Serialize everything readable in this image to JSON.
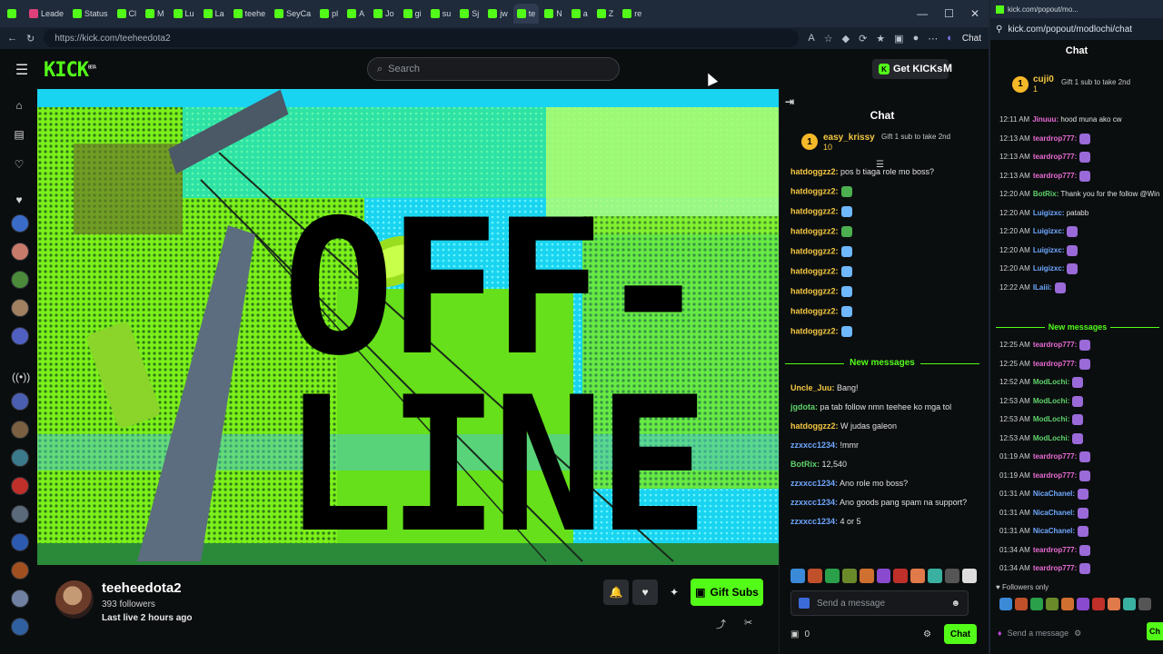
{
  "browser": {
    "tabs": [
      {
        "label": "",
        "active": false
      },
      {
        "label": "Leade",
        "active": false
      },
      {
        "label": "Status",
        "active": false
      },
      {
        "label": "Cl",
        "active": false
      },
      {
        "label": "M",
        "active": false
      },
      {
        "label": "Lu",
        "active": false
      },
      {
        "label": "La",
        "active": false
      },
      {
        "label": "teehe",
        "active": false
      },
      {
        "label": "SeyCa",
        "active": false
      },
      {
        "label": "pl",
        "active": false
      },
      {
        "label": "A",
        "active": false
      },
      {
        "label": "Jo",
        "active": false
      },
      {
        "label": "gi",
        "active": false
      },
      {
        "label": "su",
        "active": false
      },
      {
        "label": "Sj",
        "active": false
      },
      {
        "label": "jw",
        "active": false
      },
      {
        "label": "te",
        "active": true
      },
      {
        "label": "N",
        "active": false
      },
      {
        "label": "a",
        "active": false
      },
      {
        "label": "Z",
        "active": false
      },
      {
        "label": "re",
        "active": false
      }
    ],
    "url": "https://kick.com/teeheedota2",
    "copilot_label": "Chat"
  },
  "nav": {
    "logo": "KICK",
    "logo_beta": "BETA",
    "search_placeholder": "Search",
    "get_kicks": "Get KICKs",
    "user_initial": "M"
  },
  "video": {
    "line1": "OFF-",
    "line2": "LINE"
  },
  "channel": {
    "name": "teeheedota2",
    "followers": "393 followers",
    "last_live": "Last live 2 hours ago",
    "gift_subs": "Gift Subs"
  },
  "chat": {
    "title": "Chat",
    "pinned_rank": "1",
    "pinned_user": "easy_krissy",
    "pinned_count": "10",
    "gift_note": "Gift 1 sub to take 2nd",
    "messages_top": [
      {
        "user": "hatdoggzz2:",
        "text": " pos b tiaga role mo boss?",
        "color": "#f5c842"
      },
      {
        "user": "hatdoggzz2:",
        "text": "",
        "color": "#f5c842",
        "emote": "#4caf50"
      },
      {
        "user": "hatdoggzz2:",
        "text": "",
        "color": "#f5c842",
        "emote": "#6fb7ff"
      },
      {
        "user": "hatdoggzz2:",
        "text": "",
        "color": "#f5c842",
        "emote": "#4caf50"
      },
      {
        "user": "hatdoggzz2:",
        "text": "",
        "color": "#f5c842",
        "emote": "#6fb7ff"
      },
      {
        "user": "hatdoggzz2:",
        "text": "",
        "color": "#f5c842",
        "emote": "#6fb7ff"
      },
      {
        "user": "hatdoggzz2:",
        "text": "",
        "color": "#f5c842",
        "emote": "#6fb7ff"
      },
      {
        "user": "hatdoggzz2:",
        "text": "",
        "color": "#f5c842",
        "emote": "#6fb7ff"
      },
      {
        "user": "hatdoggzz2:",
        "text": "",
        "color": "#f5c842",
        "emote": "#6fb7ff"
      }
    ],
    "new_messages_label": "New messages",
    "messages_bottom": [
      {
        "user": "Uncle_Juu:",
        "text": " Bang!",
        "color": "#f5c842"
      },
      {
        "user": "jgdota:",
        "text": " pa tab follow nmn teehee ko mga tol",
        "color": "#5fd36b"
      },
      {
        "user": "hatdoggzz2:",
        "text": " W judas galeon",
        "color": "#f5c842"
      },
      {
        "user": "zzxxcc1234:",
        "text": " !mmr",
        "color": "#6fa8ff"
      },
      {
        "user": "BotRix:",
        "text": " 12,540",
        "color": "#5fd36b"
      },
      {
        "user": "zzxxcc1234:",
        "text": " Ano role mo boss?",
        "color": "#6fa8ff"
      },
      {
        "user": "zzxxcc1234:",
        "text": " Ano goods pang spam na support?",
        "color": "#6fa8ff"
      },
      {
        "user": "zzxxcc1234:",
        "text": " 4 or 5",
        "color": "#6fa8ff"
      }
    ],
    "input_placeholder": "Send a message",
    "kicks_count": "0",
    "send_label": "Chat"
  },
  "popout": {
    "tab_title": "kick.com/popout/mo...",
    "url": "kick.com/popout/modlochi/chat",
    "title": "Chat",
    "pinned_user": "cuji0",
    "pinned_count": "1",
    "gift_note": "Gift 1 sub to take 2nd",
    "messages_top": [
      {
        "time": "12:11 AM",
        "user": "Jinuuu:",
        "text": " hood muna ako cw",
        "color": "#e96bd4"
      },
      {
        "time": "12:13 AM",
        "user": "teardrop777:",
        "text": "",
        "color": "#e96bd4"
      },
      {
        "time": "12:13 AM",
        "user": "teardrop777:",
        "text": "",
        "color": "#e96bd4"
      },
      {
        "time": "12:13 AM",
        "user": "teardrop777:",
        "text": "",
        "color": "#e96bd4"
      },
      {
        "time": "12:20 AM",
        "user": "BotRix:",
        "text": " Thank you for the follow @Wintercorbs",
        "color": "#5fd36b"
      },
      {
        "time": "12:20 AM",
        "user": "Luigizxc:",
        "text": " patabb",
        "color": "#6fa8ff"
      },
      {
        "time": "12:20 AM",
        "user": "Luigizxc:",
        "text": "",
        "color": "#6fa8ff"
      },
      {
        "time": "12:20 AM",
        "user": "Luigizxc:",
        "text": "",
        "color": "#6fa8ff"
      },
      {
        "time": "12:20 AM",
        "user": "Luigizxc:",
        "text": "",
        "color": "#6fa8ff"
      },
      {
        "time": "12:22 AM",
        "user": "ILaiii:",
        "text": "",
        "color": "#6fa8ff"
      }
    ],
    "new_messages_label": "New messages",
    "messages_bottom": [
      {
        "time": "12:25 AM",
        "user": "teardrop777:",
        "text": "",
        "color": "#e96bd4"
      },
      {
        "time": "12:25 AM",
        "user": "teardrop777:",
        "text": "",
        "color": "#e96bd4"
      },
      {
        "time": "12:52 AM",
        "user": "ModLochi:",
        "text": "",
        "color": "#5fd36b"
      },
      {
        "time": "12:53 AM",
        "user": "ModLochi:",
        "text": "",
        "color": "#5fd36b"
      },
      {
        "time": "12:53 AM",
        "user": "ModLochi:",
        "text": "",
        "color": "#5fd36b"
      },
      {
        "time": "12:53 AM",
        "user": "ModLochi:",
        "text": "",
        "color": "#5fd36b"
      },
      {
        "time": "01:19 AM",
        "user": "teardrop777:",
        "text": "",
        "color": "#e96bd4"
      },
      {
        "time": "01:19 AM",
        "user": "teardrop777:",
        "text": "",
        "color": "#e96bd4"
      },
      {
        "time": "01:31 AM",
        "user": "NicaChanel:",
        "text": "",
        "color": "#6fa8ff"
      },
      {
        "time": "01:31 AM",
        "user": "NicaChanel:",
        "text": "",
        "color": "#6fa8ff"
      },
      {
        "time": "01:31 AM",
        "user": "NicaChanel:",
        "text": "",
        "color": "#6fa8ff"
      },
      {
        "time": "01:34 AM",
        "user": "teardrop777:",
        "text": "",
        "color": "#e96bd4"
      },
      {
        "time": "01:34 AM",
        "user": "teardrop777:",
        "text": "",
        "color": "#e96bd4"
      }
    ],
    "followers_only": "Followers only",
    "input_placeholder": "Send a message",
    "send_label": "Ch"
  },
  "colors": {
    "accent": "#53fc18",
    "bg": "#0b0e0f"
  }
}
